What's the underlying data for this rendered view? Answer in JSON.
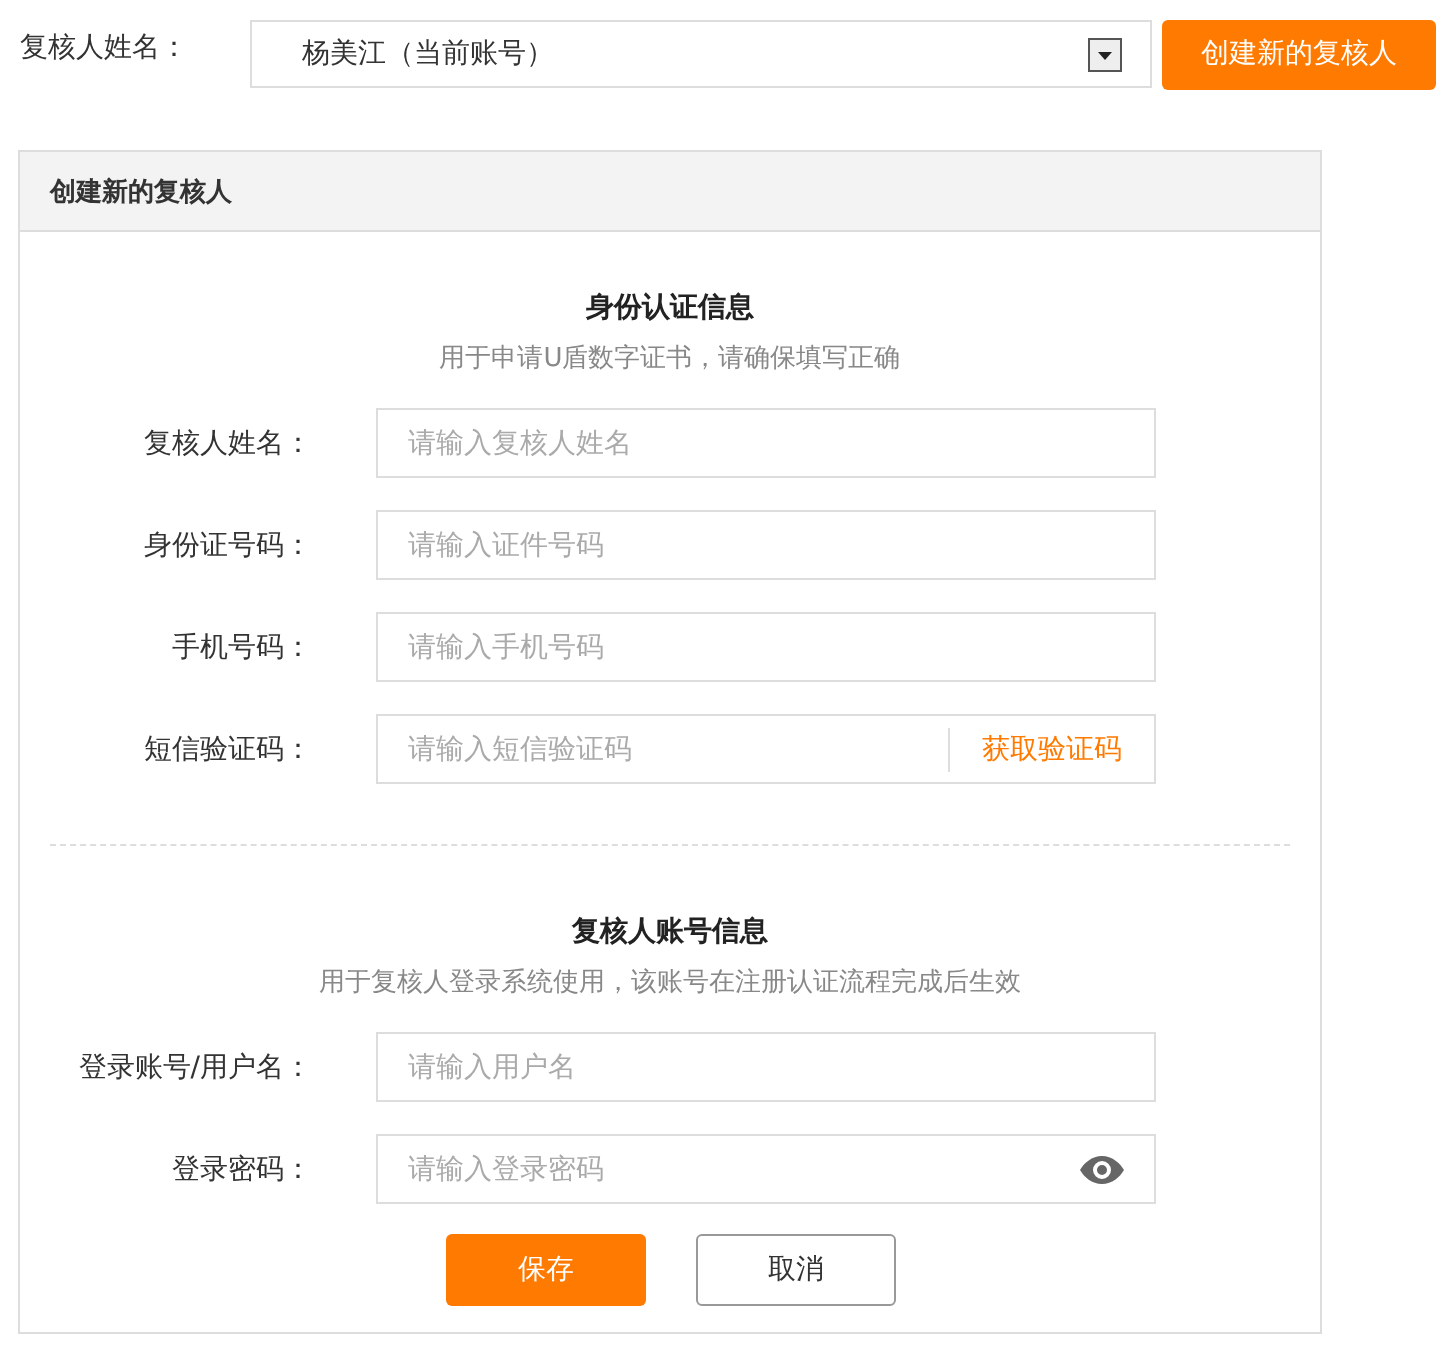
{
  "reviewer_select": {
    "label": "复核人姓名：",
    "value": "杨美江（当前账号）"
  },
  "create_button": "创建新的复核人",
  "panel": {
    "title": "创建新的复核人",
    "sections": [
      {
        "title": "身份认证信息",
        "subtitle": "用于申请U盾数字证书，请确保填写正确",
        "fields": [
          {
            "kind": "text",
            "label": "复核人姓名：",
            "placeholder": "请输入复核人姓名"
          },
          {
            "kind": "text",
            "label": "身份证号码：",
            "placeholder": "请输入证件号码"
          },
          {
            "kind": "text",
            "label": "手机号码：",
            "placeholder": "请输入手机号码"
          },
          {
            "kind": "sms",
            "label": "短信验证码：",
            "placeholder": "请输入短信验证码",
            "action": "获取验证码"
          }
        ]
      },
      {
        "title": "复核人账号信息",
        "subtitle": "用于复核人登录系统使用，该账号在注册认证流程完成后生效",
        "fields": [
          {
            "kind": "text",
            "label": "登录账号/用户名：",
            "placeholder": "请输入用户名"
          },
          {
            "kind": "password",
            "label": "登录密码：",
            "placeholder": "请输入登录密码"
          }
        ]
      }
    ],
    "buttons": [
      {
        "kind": "primary",
        "label": "保存"
      },
      {
        "kind": "secondary",
        "label": "取消"
      }
    ]
  }
}
